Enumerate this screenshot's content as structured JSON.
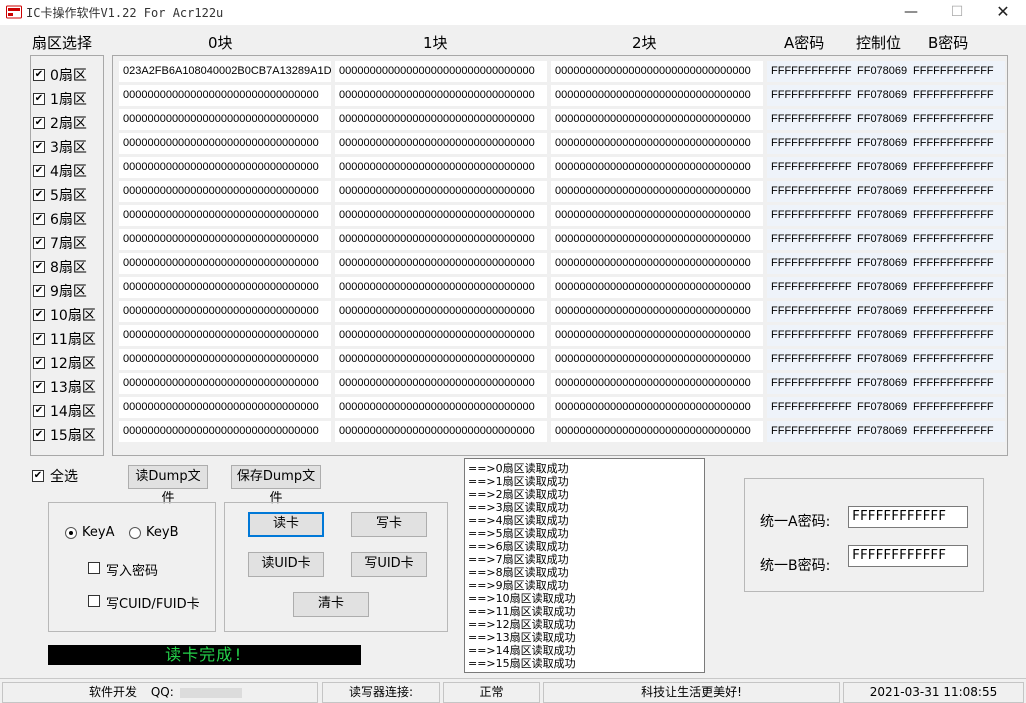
{
  "window": {
    "title": "IC卡操作软件V1.22 For Acr122u",
    "minimize_glyph": "—",
    "maximize_glyph": "☐",
    "close_glyph": "✕"
  },
  "headers": {
    "sector_select": "扇区选择",
    "block0": "0块",
    "block1": "1块",
    "block2": "2块",
    "key_a": "A密码",
    "control": "控制位",
    "key_b": "B密码"
  },
  "sectors": [
    {
      "label": "0扇区",
      "checked": true
    },
    {
      "label": "1扇区",
      "checked": true
    },
    {
      "label": "2扇区",
      "checked": true
    },
    {
      "label": "3扇区",
      "checked": true
    },
    {
      "label": "4扇区",
      "checked": true
    },
    {
      "label": "5扇区",
      "checked": true
    },
    {
      "label": "6扇区",
      "checked": true
    },
    {
      "label": "7扇区",
      "checked": true
    },
    {
      "label": "8扇区",
      "checked": true
    },
    {
      "label": "9扇区",
      "checked": true
    },
    {
      "label": "10扇区",
      "checked": true
    },
    {
      "label": "11扇区",
      "checked": true
    },
    {
      "label": "12扇区",
      "checked": true
    },
    {
      "label": "13扇区",
      "checked": true
    },
    {
      "label": "14扇区",
      "checked": true
    },
    {
      "label": "15扇区",
      "checked": true
    }
  ],
  "rows": [
    {
      "b0": "023A2FB6A108040002B0CB7A13289A1D",
      "b1": "00000000000000000000000000000000",
      "b2": "00000000000000000000000000000000",
      "ka": "FFFFFFFFFFFF",
      "ctl": "FF078069",
      "kb": "FFFFFFFFFFFF"
    },
    {
      "b0": "00000000000000000000000000000000",
      "b1": "00000000000000000000000000000000",
      "b2": "00000000000000000000000000000000",
      "ka": "FFFFFFFFFFFF",
      "ctl": "FF078069",
      "kb": "FFFFFFFFFFFF"
    },
    {
      "b0": "00000000000000000000000000000000",
      "b1": "00000000000000000000000000000000",
      "b2": "00000000000000000000000000000000",
      "ka": "FFFFFFFFFFFF",
      "ctl": "FF078069",
      "kb": "FFFFFFFFFFFF"
    },
    {
      "b0": "00000000000000000000000000000000",
      "b1": "00000000000000000000000000000000",
      "b2": "00000000000000000000000000000000",
      "ka": "FFFFFFFFFFFF",
      "ctl": "FF078069",
      "kb": "FFFFFFFFFFFF"
    },
    {
      "b0": "00000000000000000000000000000000",
      "b1": "00000000000000000000000000000000",
      "b2": "00000000000000000000000000000000",
      "ka": "FFFFFFFFFFFF",
      "ctl": "FF078069",
      "kb": "FFFFFFFFFFFF"
    },
    {
      "b0": "00000000000000000000000000000000",
      "b1": "00000000000000000000000000000000",
      "b2": "00000000000000000000000000000000",
      "ka": "FFFFFFFFFFFF",
      "ctl": "FF078069",
      "kb": "FFFFFFFFFFFF"
    },
    {
      "b0": "00000000000000000000000000000000",
      "b1": "00000000000000000000000000000000",
      "b2": "00000000000000000000000000000000",
      "ka": "FFFFFFFFFFFF",
      "ctl": "FF078069",
      "kb": "FFFFFFFFFFFF"
    },
    {
      "b0": "00000000000000000000000000000000",
      "b1": "00000000000000000000000000000000",
      "b2": "00000000000000000000000000000000",
      "ka": "FFFFFFFFFFFF",
      "ctl": "FF078069",
      "kb": "FFFFFFFFFFFF"
    },
    {
      "b0": "00000000000000000000000000000000",
      "b1": "00000000000000000000000000000000",
      "b2": "00000000000000000000000000000000",
      "ka": "FFFFFFFFFFFF",
      "ctl": "FF078069",
      "kb": "FFFFFFFFFFFF"
    },
    {
      "b0": "00000000000000000000000000000000",
      "b1": "00000000000000000000000000000000",
      "b2": "00000000000000000000000000000000",
      "ka": "FFFFFFFFFFFF",
      "ctl": "FF078069",
      "kb": "FFFFFFFFFFFF"
    },
    {
      "b0": "00000000000000000000000000000000",
      "b1": "00000000000000000000000000000000",
      "b2": "00000000000000000000000000000000",
      "ka": "FFFFFFFFFFFF",
      "ctl": "FF078069",
      "kb": "FFFFFFFFFFFF"
    },
    {
      "b0": "00000000000000000000000000000000",
      "b1": "00000000000000000000000000000000",
      "b2": "00000000000000000000000000000000",
      "ka": "FFFFFFFFFFFF",
      "ctl": "FF078069",
      "kb": "FFFFFFFFFFFF"
    },
    {
      "b0": "00000000000000000000000000000000",
      "b1": "00000000000000000000000000000000",
      "b2": "00000000000000000000000000000000",
      "ka": "FFFFFFFFFFFF",
      "ctl": "FF078069",
      "kb": "FFFFFFFFFFFF"
    },
    {
      "b0": "00000000000000000000000000000000",
      "b1": "00000000000000000000000000000000",
      "b2": "00000000000000000000000000000000",
      "ka": "FFFFFFFFFFFF",
      "ctl": "FF078069",
      "kb": "FFFFFFFFFFFF"
    },
    {
      "b0": "00000000000000000000000000000000",
      "b1": "00000000000000000000000000000000",
      "b2": "00000000000000000000000000000000",
      "ka": "FFFFFFFFFFFF",
      "ctl": "FF078069",
      "kb": "FFFFFFFFFFFF"
    },
    {
      "b0": "00000000000000000000000000000000",
      "b1": "00000000000000000000000000000000",
      "b2": "00000000000000000000000000000000",
      "ka": "FFFFFFFFFFFF",
      "ctl": "FF078069",
      "kb": "FFFFFFFFFFFF"
    }
  ],
  "select_all": {
    "label": "全选",
    "checked": true
  },
  "buttons": {
    "read_dump": "读Dump文件",
    "save_dump": "保存Dump文件",
    "read_card": "读卡",
    "write_card": "写卡",
    "read_uid": "读UID卡",
    "write_uid": "写UID卡",
    "clear_card": "清卡"
  },
  "options": {
    "key_a": {
      "label": "KeyA",
      "selected": true
    },
    "key_b": {
      "label": "KeyB",
      "selected": false
    },
    "write_password": {
      "label": "写入密码",
      "checked": false
    },
    "write_cuid": {
      "label": "写CUID/FUID卡",
      "checked": false
    }
  },
  "log": [
    "==>0扇区读取成功",
    "==>1扇区读取成功",
    "==>2扇区读取成功",
    "==>3扇区读取成功",
    "==>4扇区读取成功",
    "==>5扇区读取成功",
    "==>6扇区读取成功",
    "==>7扇区读取成功",
    "==>8扇区读取成功",
    "==>9扇区读取成功",
    "==>10扇区读取成功",
    "==>11扇区读取成功",
    "==>12扇区读取成功",
    "==>13扇区读取成功",
    "==>14扇区读取成功",
    "==>15扇区读取成功"
  ],
  "status_message": "读卡完成!",
  "unified": {
    "key_a_label": "统一A密码:",
    "key_a_value": "FFFFFFFFFFFF",
    "key_b_label": "统一B密码:",
    "key_b_value": "FFFFFFFFFFFF"
  },
  "statusbar": {
    "dev": "软件开发",
    "qq": "QQ:",
    "reader_label": "读写器连接:",
    "reader_state": "正常",
    "slogan": "科技让生活更美好!",
    "datetime": "2021-03-31 11:08:55"
  },
  "colors": {
    "status_text": "#24d24a",
    "focus_border": "#0078d7",
    "key_cell_bg": "#eef3fa"
  }
}
